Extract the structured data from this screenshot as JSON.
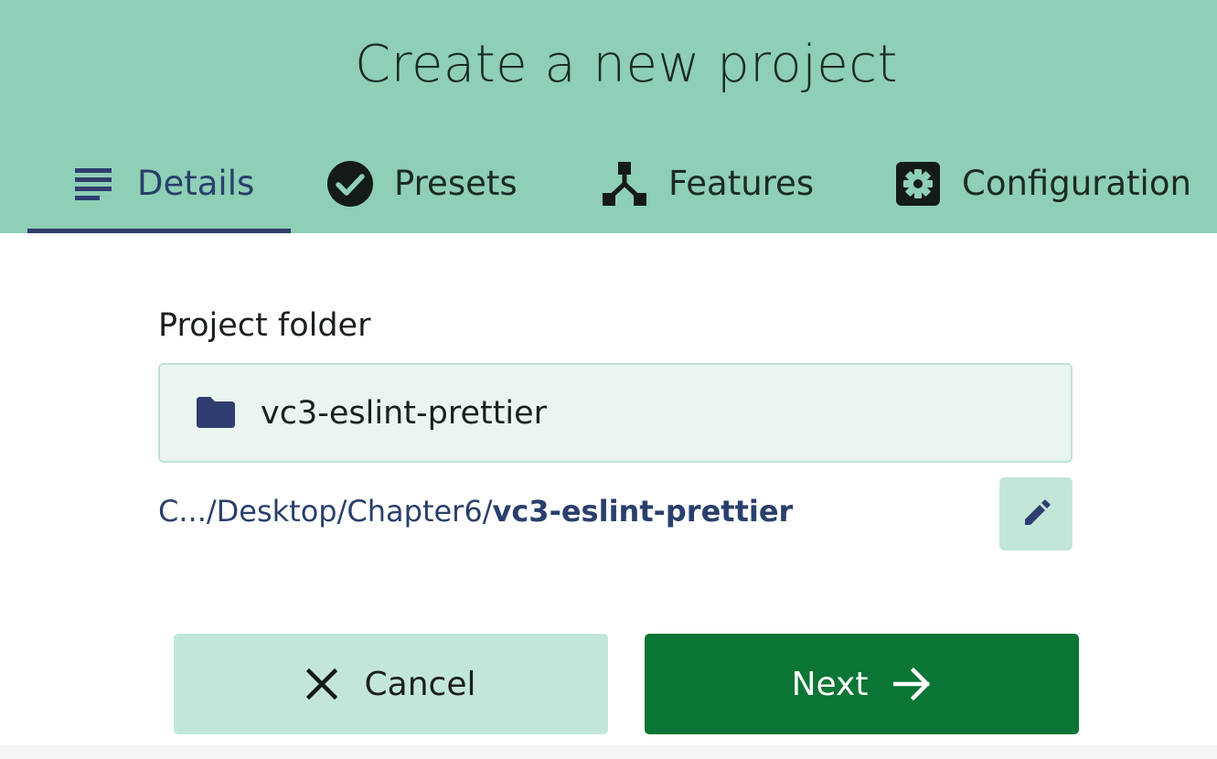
{
  "header": {
    "title": "Create a new project",
    "background_color": "#8ecfb6"
  },
  "tabs": [
    {
      "label": "Details",
      "icon": "list-icon",
      "active": true
    },
    {
      "label": "Presets",
      "icon": "check-circle-icon",
      "active": false
    },
    {
      "label": "Features",
      "icon": "fork-icon",
      "active": false
    },
    {
      "label": "Configuration",
      "icon": "gear-icon",
      "active": false
    }
  ],
  "project_folder": {
    "label": "Project folder",
    "value": "vc3-eslint-prettier",
    "icon": "folder-icon",
    "path_prefix": "C.../Desktop/Chapter6/",
    "path_name": "vc3-eslint-prettier",
    "edit_icon": "pencil-icon"
  },
  "actions": {
    "cancel_label": "Cancel",
    "cancel_icon": "close-icon",
    "next_label": "Next",
    "next_icon": "arrow-right-icon",
    "next_color": "#0a7534"
  }
}
